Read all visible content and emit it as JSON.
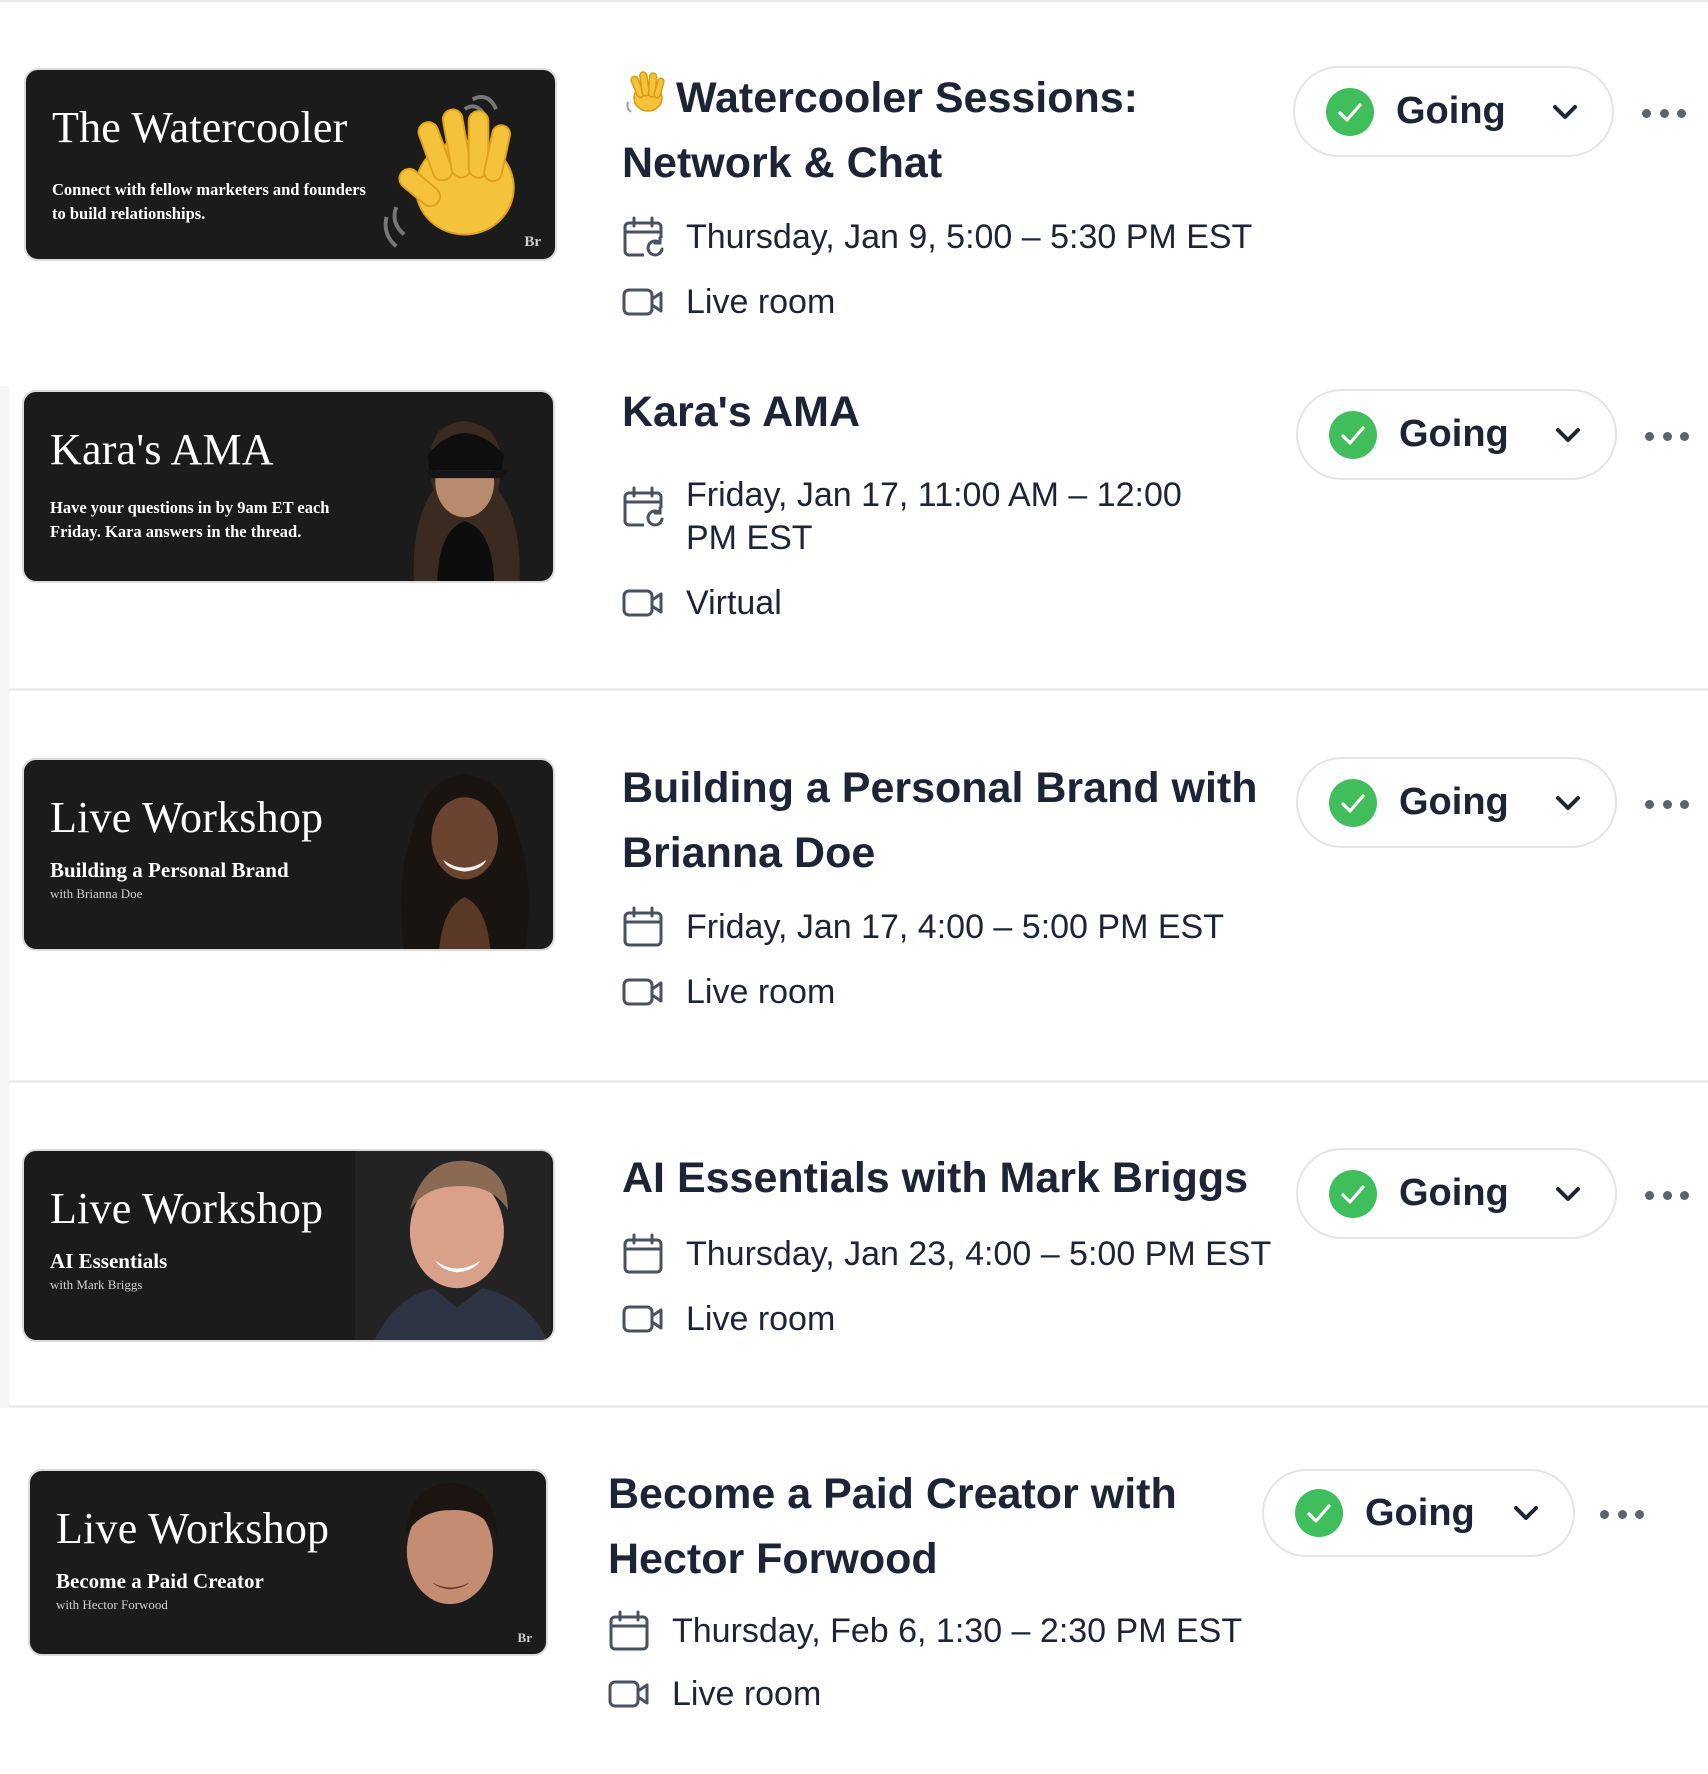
{
  "rsvp_status_label": "Going",
  "colors": {
    "going_green": "#3fbe5b",
    "text_dark": "#1c2436",
    "thumb_bg": "#1b1b1b"
  },
  "icons": {
    "calendar": "calendar-icon",
    "recurring_calendar": "calendar-repeat-icon",
    "video": "video-camera-icon",
    "check": "check-circle-icon",
    "chevron": "chevron-down-icon",
    "more": "more-horizontal-icon"
  },
  "events": [
    {
      "thumbnail": {
        "title": "The Watercooler",
        "subtitle": "Connect with fellow marketers and founders to build relationships.",
        "logo": "Br"
      },
      "title": "Watercooler Sessions: Network & Chat",
      "title_emoji": "waving-hand",
      "datetime": "Thursday, Jan 9, 5:00 – 5:30 PM EST",
      "location": "Live room",
      "rsvp": "Going"
    },
    {
      "thumbnail": {
        "title": "Kara's AMA",
        "subtitle": "Have your questions in by 9am ET each Friday. Kara answers in the thread."
      },
      "title": "Kara's AMA",
      "datetime": "Friday, Jan 17, 11:00 AM – 12:00 PM EST",
      "location": "Virtual",
      "rsvp": "Going"
    },
    {
      "thumbnail": {
        "title": "Live Workshop",
        "subtitle": "Building a Personal Brand",
        "with": "with Brianna Doe"
      },
      "title": "Building a Personal Brand with Brianna Doe",
      "datetime": "Friday, Jan 17, 4:00 – 5:00 PM EST",
      "location": "Live room",
      "rsvp": "Going"
    },
    {
      "thumbnail": {
        "title": "Live Workshop",
        "subtitle": "AI Essentials",
        "with": "with Mark Briggs"
      },
      "title": "AI Essentials with Mark Briggs",
      "datetime": "Thursday, Jan 23, 4:00 – 5:00 PM EST",
      "location": "Live room",
      "rsvp": "Going"
    },
    {
      "thumbnail": {
        "title": "Live Workshop",
        "subtitle": "Become a Paid Creator",
        "with": "with Hector Forwood"
      },
      "title": "Become a Paid Creator with Hector Forwood",
      "datetime": "Thursday, Feb 6, 1:30 – 2:30 PM EST",
      "location": "Live room",
      "rsvp": "Going"
    }
  ]
}
